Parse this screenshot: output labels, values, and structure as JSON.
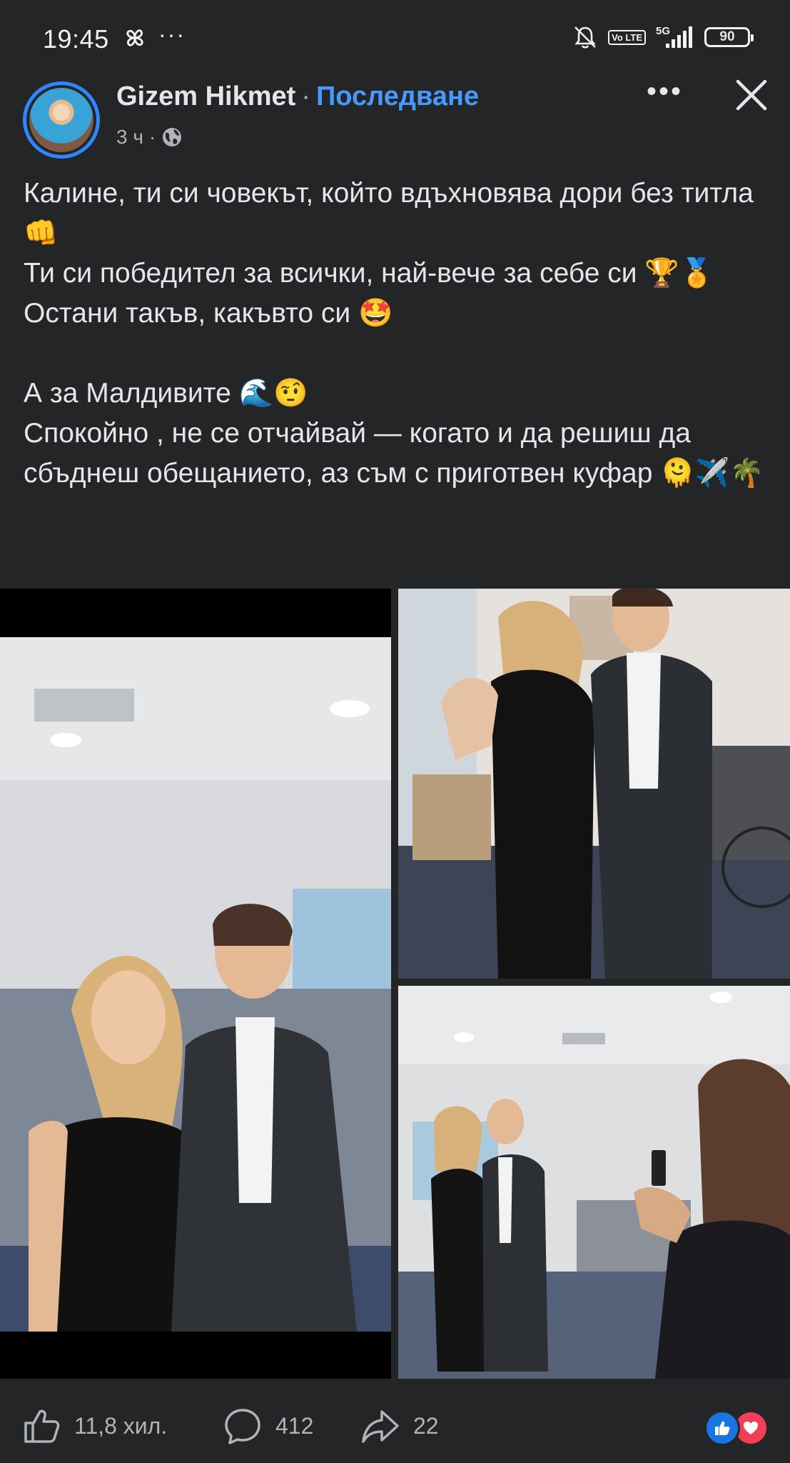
{
  "status_bar": {
    "time": "19:45",
    "extra": "···",
    "volte": "Vo LTE",
    "network": "5G",
    "battery": "90",
    "icons": [
      "pinwheel-icon",
      "mute-bell-icon",
      "volte-icon",
      "signal-icon",
      "battery-icon"
    ]
  },
  "post": {
    "author": "Gizem Hikmet",
    "separator": "·",
    "follow_label": "Последване",
    "time": "3 ч",
    "meta_separator": "·",
    "visibility_icon": "globe-icon",
    "more_label": "•••",
    "lines": [
      "Калине, ти си човекът, който вдъхновява дори без титла 👊",
      "Ти си победител за всички, най-вече за себе си 🏆🏅",
      "Остани такъв, какъвто си 🤩",
      "",
      "А за Малдивите 🌊🤨",
      "Спокойно , не се отчайвай — когато и да решиш да сбъднеш обещанието, аз съм с приготвен куфар 🫠✈️🌴"
    ]
  },
  "actions": {
    "likes": "11,8 хил.",
    "comments": "412",
    "shares": "22"
  },
  "colors": {
    "background": "#242526",
    "text": "#e4e6eb",
    "secondary": "#b0b3b8",
    "accent": "#4599ff",
    "like": "#1b74e4",
    "love": "#f33e58"
  }
}
